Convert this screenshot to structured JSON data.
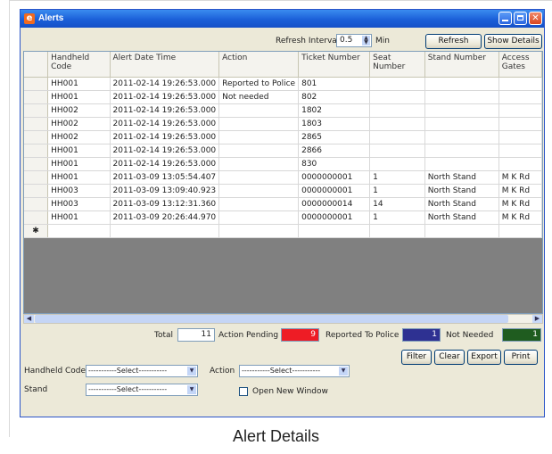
{
  "window": {
    "title": "Alerts"
  },
  "toolbar": {
    "refresh_interval_label": "Refresh Interval",
    "refresh_interval_value": "0.5",
    "refresh_interval_unit": "Min",
    "refresh_button": "Refresh",
    "show_details_button": "Show Details"
  },
  "grid": {
    "columns": [
      "Handheld Code",
      "Alert Date Time",
      "Action",
      "Ticket Number",
      "Seat Number",
      "Stand Number",
      "Access Gates"
    ],
    "rows": [
      [
        "HH001",
        "2011-02-14 19:26:53.000",
        "Reported to Police",
        "801",
        "",
        "",
        ""
      ],
      [
        "HH001",
        "2011-02-14 19:26:53.000",
        "Not needed",
        "802",
        "",
        "",
        ""
      ],
      [
        "HH002",
        "2011-02-14 19:26:53.000",
        "",
        "1802",
        "",
        "",
        ""
      ],
      [
        "HH002",
        "2011-02-14 19:26:53.000",
        "",
        "1803",
        "",
        "",
        ""
      ],
      [
        "HH002",
        "2011-02-14 19:26:53.000",
        "",
        "2865",
        "",
        "",
        ""
      ],
      [
        "HH001",
        "2011-02-14 19:26:53.000",
        "",
        "2866",
        "",
        "",
        ""
      ],
      [
        "HH001",
        "2011-02-14 19:26:53.000",
        "",
        "830",
        "",
        "",
        ""
      ],
      [
        "HH001",
        "2011-03-09 13:05:54.407",
        "",
        "0000000001",
        "1",
        "North Stand",
        "M K Rd"
      ],
      [
        "HH003",
        "2011-03-09 13:09:40.923",
        "",
        "0000000001",
        "1",
        "North Stand",
        "M K Rd"
      ],
      [
        "HH003",
        "2011-03-09 13:12:31.360",
        "",
        "0000000014",
        "14",
        "North Stand",
        "M K Rd"
      ],
      [
        "HH001",
        "2011-03-09 20:26:44.970",
        "",
        "0000000001",
        "1",
        "North Stand",
        "M K Rd"
      ]
    ],
    "new_row_marker": "✱"
  },
  "summary": {
    "total_label": "Total",
    "total_value": "11",
    "pending_label": "Action Pending",
    "pending_value": "9",
    "reported_label": "Reported To Police",
    "reported_value": "1",
    "notneeded_label": "Not Needed",
    "notneeded_value": "1"
  },
  "actions": {
    "filter": "Filter",
    "clear": "Clear",
    "export": "Export",
    "print": "Print"
  },
  "filters": {
    "handheld_label": "Handheld Code",
    "handheld_value": "-----------Select-----------",
    "action_label": "Action",
    "action_value": "-----------Select-----------",
    "stand_label": "Stand",
    "stand_value": "-----------Select-----------",
    "open_new_window_label": "Open New Window"
  },
  "caption": "Alert Details",
  "colors": {
    "pending": "#ee1c25",
    "reported": "#2e3192",
    "notneeded": "#1f5c1f",
    "titlebar": "#1b5fd8"
  },
  "icons": [
    "app-icon",
    "minimize-icon",
    "maximize-icon",
    "close-icon",
    "spin-up-icon",
    "spin-down-icon",
    "dropdown-arrow-icon",
    "scroll-left-icon",
    "scroll-right-icon"
  ]
}
